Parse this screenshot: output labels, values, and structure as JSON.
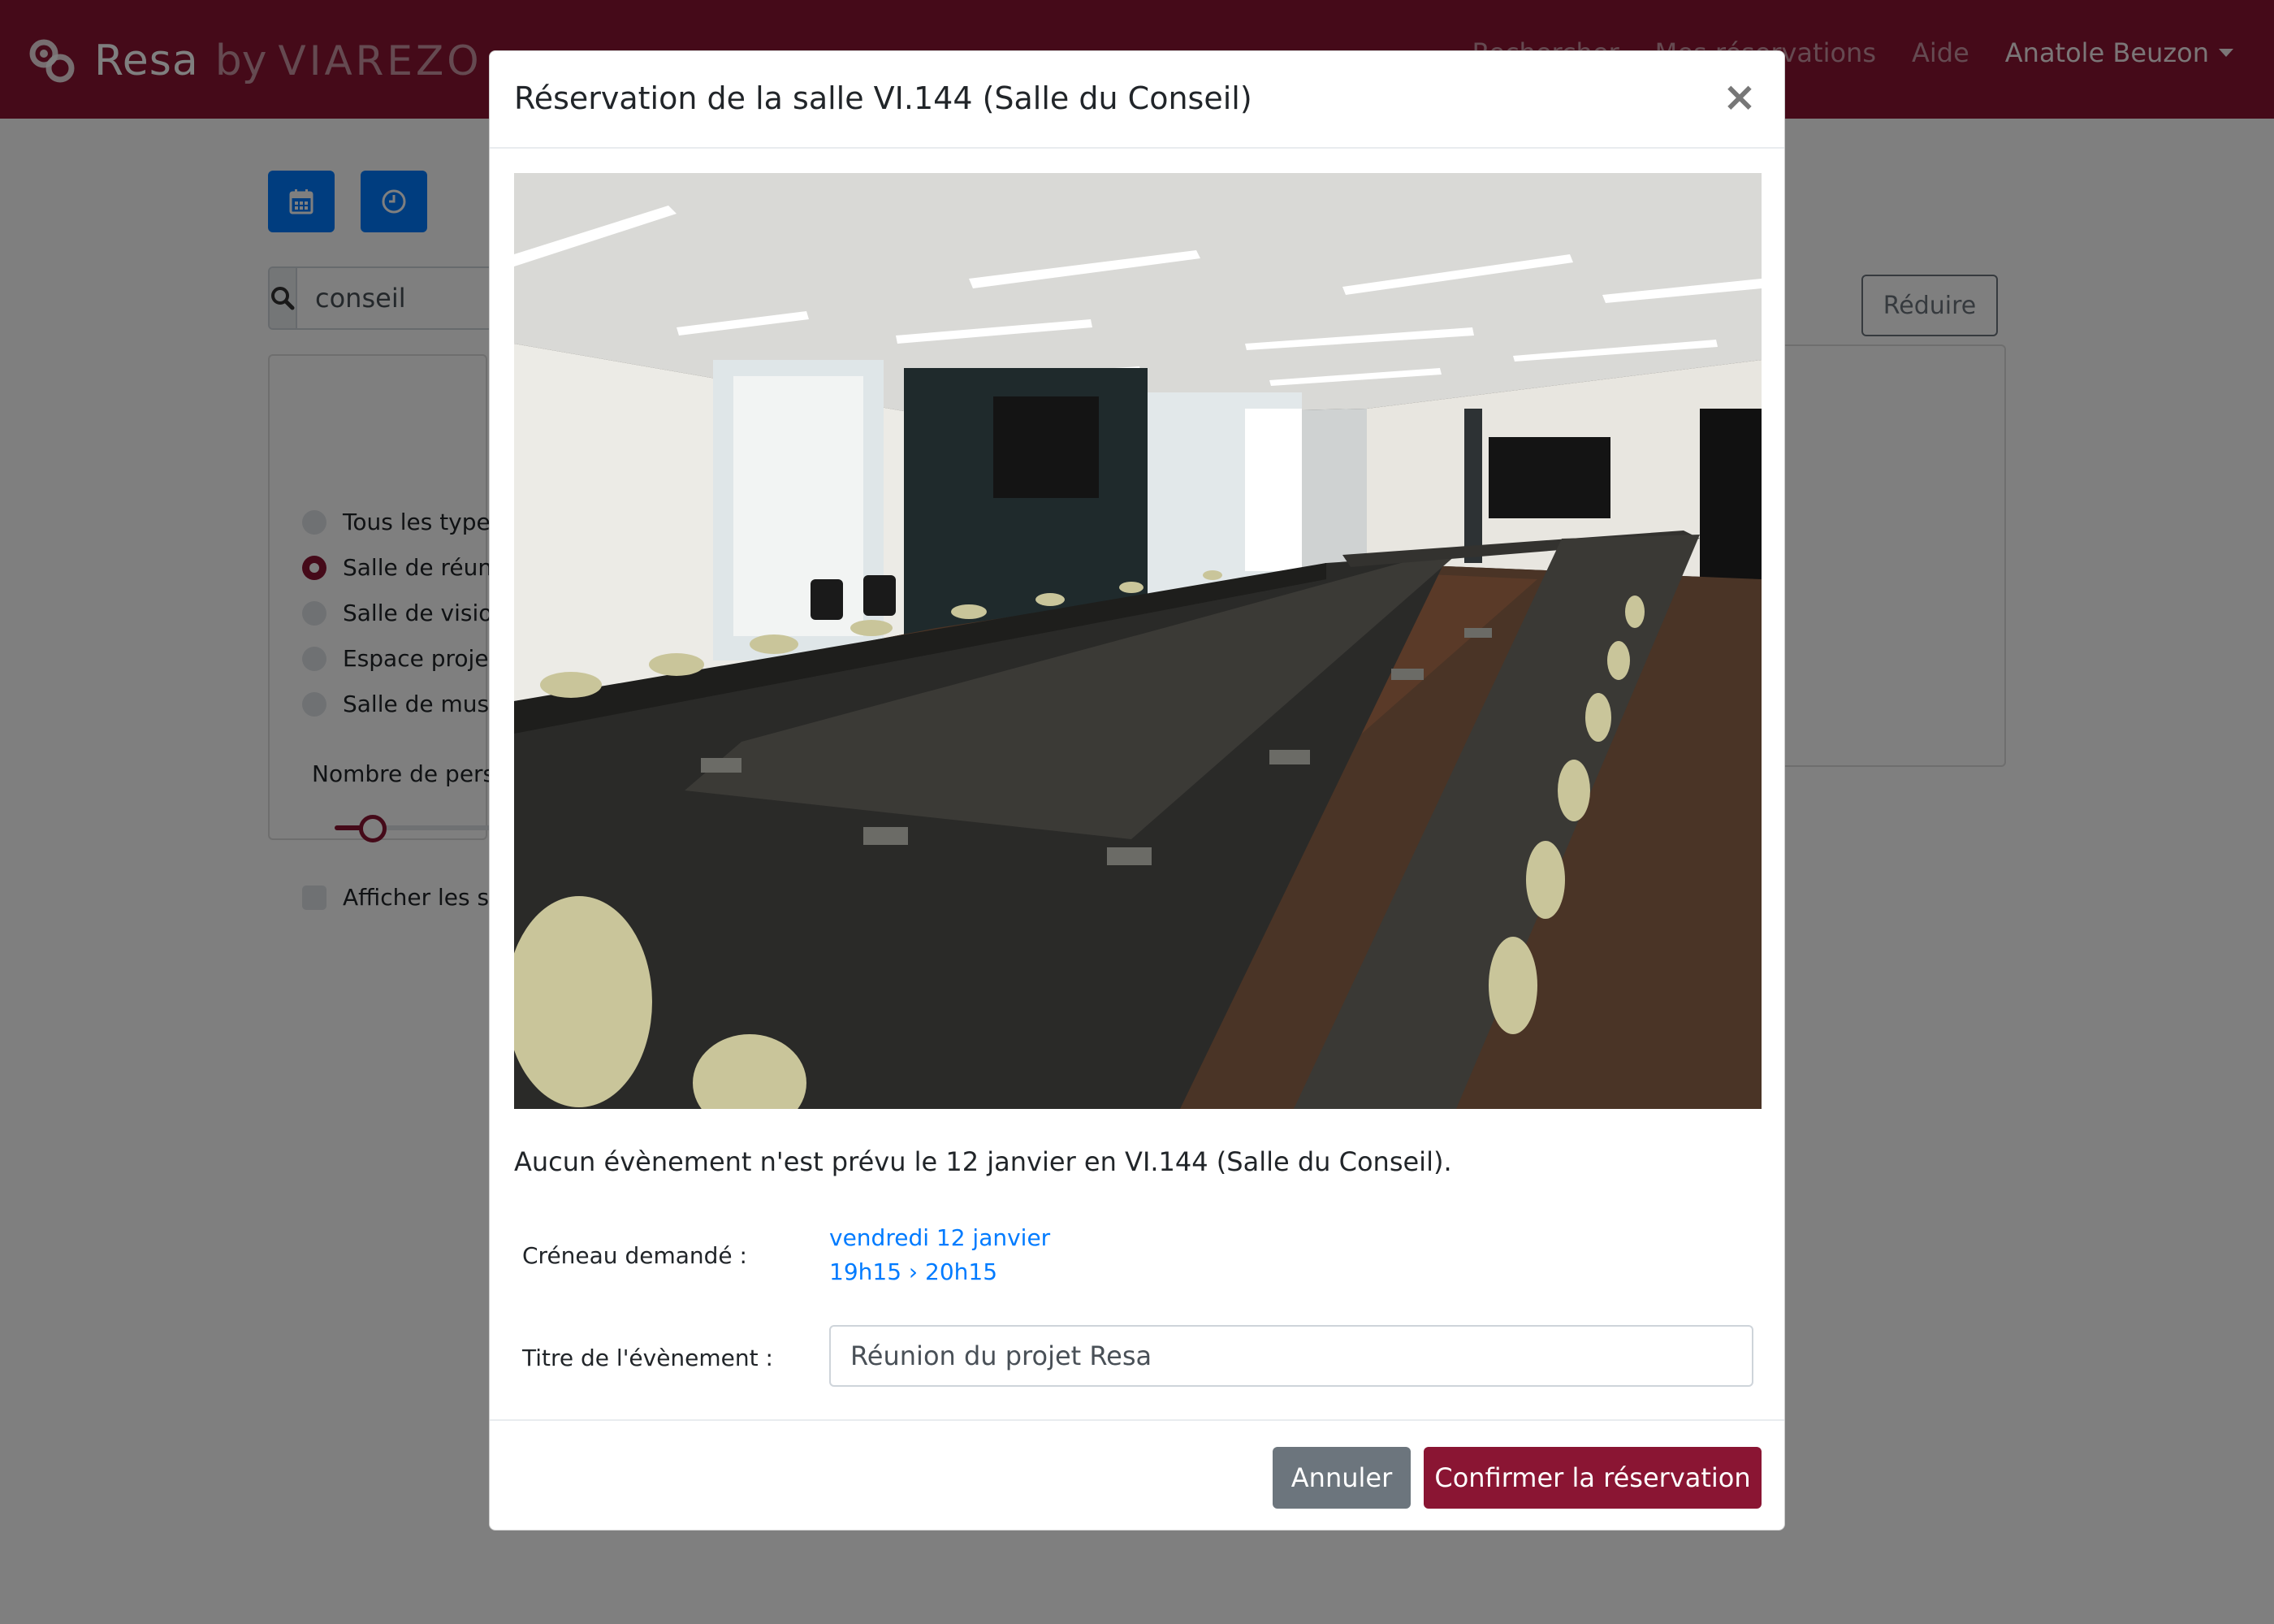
{
  "navbar": {
    "brand_name": "Resa",
    "brand_by": "by",
    "brand_org": "VIAREZO",
    "links": [
      "Rechercher",
      "Mes réservations",
      "Aide"
    ],
    "user_name": "Anatole Beuzon",
    "background_color": "#8a1533"
  },
  "toolbar": {
    "calendar_icon": "calendar-icon",
    "clock_icon": "clock-icon",
    "accent_color": "#007bff"
  },
  "search": {
    "icon": "search-icon",
    "value": "conseil"
  },
  "filters": {
    "room_types": [
      {
        "label": "Tous les types",
        "checked": false
      },
      {
        "label": "Salle de réunion",
        "checked": true
      },
      {
        "label": "Salle de visioconférence",
        "checked": false
      },
      {
        "label": "Espace projet",
        "checked": false
      },
      {
        "label": "Salle de musique",
        "checked": false
      }
    ],
    "persons_label": "Nombre de personnes",
    "show_unavailable_label": "Afficher les salles",
    "reduce_button": "Réduire"
  },
  "modal": {
    "title": "Réservation de la salle VI.144 (Salle du Conseil)",
    "close_icon": "close-icon",
    "photo_description": "room-photo",
    "message": "Aucun évènement n'est prévu le 12 janvier en VI.144 (Salle du Conseil).",
    "slot_label": "Créneau demandé :",
    "slot_date": "vendredi 12 janvier",
    "slot_time": "19h15 › 20h15",
    "event_title_label": "Titre de l'évènement :",
    "event_title_value": "Réunion du projet Resa",
    "cancel_button": "Annuler",
    "confirm_button": "Confirmer la réservation",
    "primary_color": "#8a1533",
    "secondary_color": "#6c757d"
  }
}
